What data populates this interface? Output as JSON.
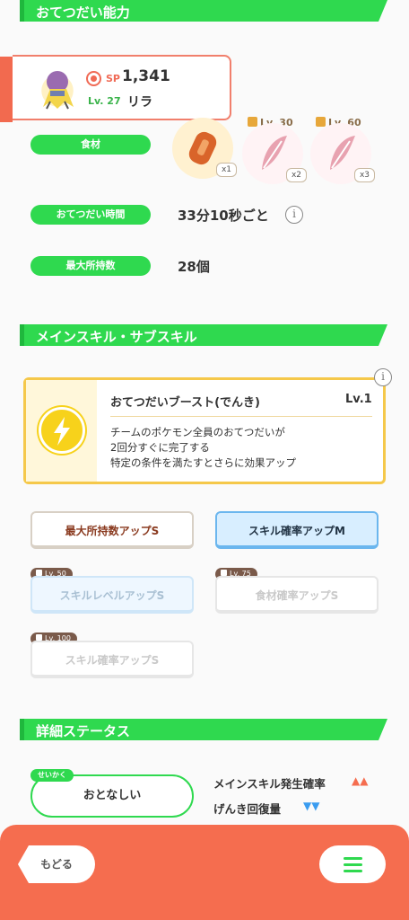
{
  "sections": {
    "help": "おてつだい能力",
    "skills": "メインスキル・サブスキル",
    "details": "詳細ステータス"
  },
  "pokemon": {
    "sp_label": "SP",
    "sp_value": "1,341",
    "level": "Lv. 27",
    "nickname": "リラ"
  },
  "help_ability": {
    "ingredients_label": "食材",
    "ingredients": [
      {
        "name": "bean-icon",
        "count": "x1",
        "unlock": ""
      },
      {
        "name": "leaf-icon",
        "count": "x2",
        "unlock": "Lv. 30"
      },
      {
        "name": "leaf-icon",
        "count": "x3",
        "unlock": "Lv. 60"
      }
    ],
    "help_time_label": "おてつだい時間",
    "help_time_value": "33分10秒ごと",
    "max_carry_label": "最大所持数",
    "max_carry_value": "28個"
  },
  "main_skill": {
    "name": "おてつだいブースト(でんき)",
    "level": "Lv.1",
    "desc_line1": "チームのポケモン全員のおてつだいが",
    "desc_line2": "2回分すぐに完了する",
    "desc_line3": "特定の条件を満たすとさらに効果アップ"
  },
  "sub_skills": [
    {
      "label": "最大所持数アップS",
      "lv": ""
    },
    {
      "label": "スキル確率アップM",
      "lv": ""
    },
    {
      "label": "スキルレベルアップS",
      "lv": "Lv. 50"
    },
    {
      "label": "食材確率アップS",
      "lv": "Lv. 75"
    },
    {
      "label": "スキル確率アップS",
      "lv": "Lv. 100"
    }
  ],
  "details": {
    "nature_tag": "せいかく",
    "nature": "おとなしい",
    "stat_up": "メインスキル発生確率",
    "stat_down": "げんき回復量",
    "up_arrows": "▲▲",
    "down_arrows": "▼▼"
  },
  "nav": {
    "back": "もどる"
  },
  "colors": {
    "green": "#2fd94f",
    "orange": "#f56d4f",
    "gold": "#f5c84a"
  }
}
